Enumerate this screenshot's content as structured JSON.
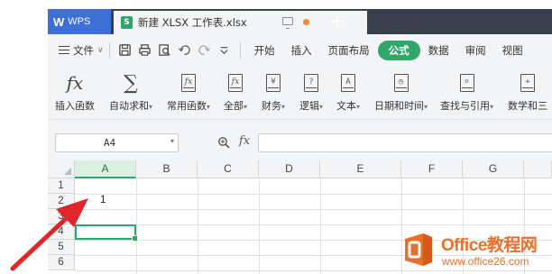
{
  "titlebar": {
    "app_name": "WPS",
    "app_logo": "W",
    "document_title": "新建 XLSX 工作表.xlsx",
    "new_tab_symbol": "+"
  },
  "menubar": {
    "file_label": "文件",
    "tabs": [
      {
        "label": "开始",
        "active": false
      },
      {
        "label": "插入",
        "active": false
      },
      {
        "label": "页面布局",
        "active": false
      },
      {
        "label": "公式",
        "active": true
      },
      {
        "label": "数据",
        "active": false
      },
      {
        "label": "审阅",
        "active": false
      },
      {
        "label": "视图",
        "active": false
      }
    ],
    "quick_access_icons": [
      "save-icon",
      "print-icon",
      "print-preview-icon",
      "undo-icon",
      "redo-icon",
      "customize-icon"
    ]
  },
  "ribbon": {
    "buttons": [
      {
        "label": "插入函数",
        "icon": "fx-icon",
        "dropdown": false
      },
      {
        "label": "自动求和",
        "icon": "sigma-icon",
        "dropdown": true
      },
      {
        "label": "常用函数",
        "icon": "common-functions-icon",
        "dropdown": true
      },
      {
        "label": "全部",
        "icon": "all-functions-icon",
        "dropdown": true
      },
      {
        "label": "财务",
        "icon": "financial-icon",
        "glyph": "¥",
        "dropdown": true
      },
      {
        "label": "逻辑",
        "icon": "logical-icon",
        "glyph": "?",
        "dropdown": true
      },
      {
        "label": "文本",
        "icon": "text-icon",
        "glyph": "A",
        "dropdown": true
      },
      {
        "label": "日期和时间",
        "icon": "date-time-icon",
        "glyph": "◷",
        "dropdown": true
      },
      {
        "label": "查找与引用",
        "icon": "lookup-icon",
        "glyph": "⌕",
        "dropdown": true
      },
      {
        "label": "数学和三",
        "icon": "math-icon",
        "glyph": "+",
        "dropdown": false
      }
    ],
    "fx_glyph": "fx",
    "sigma_glyph": "∑"
  },
  "formula_bar": {
    "name_box_value": "A4",
    "fx_label": "fx",
    "formula_value": ""
  },
  "sheet": {
    "columns": [
      "A",
      "B",
      "C",
      "D",
      "E",
      "F",
      "G"
    ],
    "selected_column": "A",
    "rows": [
      "1",
      "2",
      "3",
      "4",
      "5",
      "6"
    ],
    "active_cell": "A4",
    "cells": {
      "A2": "1"
    }
  },
  "watermark": {
    "title": "Office教程网",
    "url": "www.office26.com"
  },
  "colors": {
    "accent": "#2ea769",
    "titlebar": "#3a3f4d",
    "wps_tab": "#3d6fd6",
    "arrow": "#e0262b",
    "watermark": "#e9702a"
  }
}
